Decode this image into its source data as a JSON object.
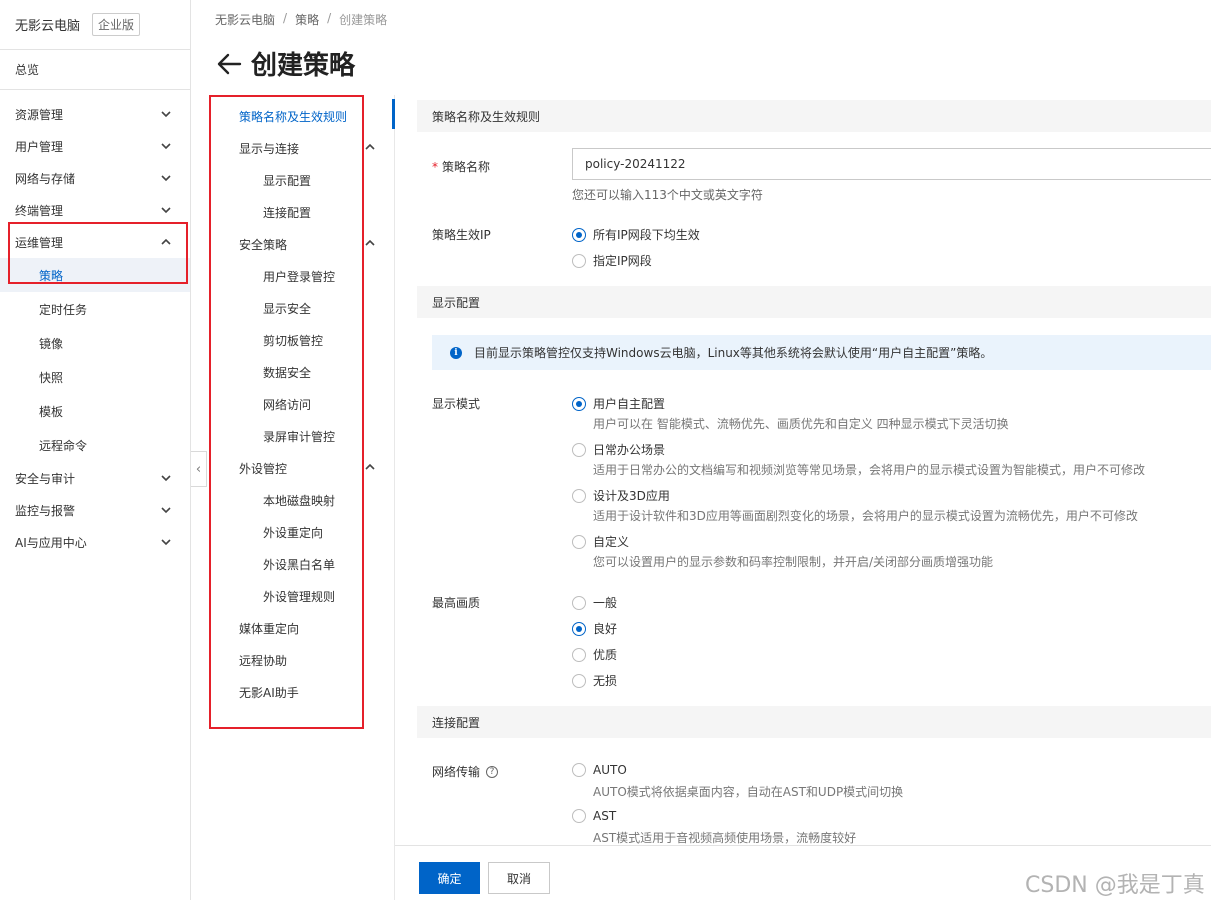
{
  "sidebar": {
    "brand": "无影云电脑",
    "edition": "企业版",
    "overview": "总览",
    "groups": [
      {
        "label": "资源管理",
        "expanded": false
      },
      {
        "label": "用户管理",
        "expanded": false
      },
      {
        "label": "网络与存储",
        "expanded": false
      },
      {
        "label": "终端管理",
        "expanded": false
      },
      {
        "label": "运维管理",
        "expanded": true
      },
      {
        "label": "安全与审计",
        "expanded": false
      },
      {
        "label": "监控与报警",
        "expanded": false
      },
      {
        "label": "AI与应用中心",
        "expanded": false
      }
    ],
    "ops_items": [
      "策略",
      "定时任务",
      "镜像",
      "快照",
      "模板",
      "远程命令"
    ],
    "active_item": "策略"
  },
  "breadcrumb": [
    "无影云电脑",
    "策略",
    "创建策略"
  ],
  "page_title": "创建策略",
  "anchor_nav": [
    {
      "label": "策略名称及生效规则",
      "level": 1,
      "active": true
    },
    {
      "label": "显示与连接",
      "level": 1,
      "collapsible": true
    },
    {
      "label": "显示配置",
      "level": 2
    },
    {
      "label": "连接配置",
      "level": 2
    },
    {
      "label": "安全策略",
      "level": 1,
      "collapsible": true
    },
    {
      "label": "用户登录管控",
      "level": 2
    },
    {
      "label": "显示安全",
      "level": 2
    },
    {
      "label": "剪切板管控",
      "level": 2
    },
    {
      "label": "数据安全",
      "level": 2
    },
    {
      "label": "网络访问",
      "level": 2
    },
    {
      "label": "录屏审计管控",
      "level": 2
    },
    {
      "label": "外设管控",
      "level": 1,
      "collapsible": true
    },
    {
      "label": "本地磁盘映射",
      "level": 2
    },
    {
      "label": "外设重定向",
      "level": 2
    },
    {
      "label": "外设黑白名单",
      "level": 2
    },
    {
      "label": "外设管理规则",
      "level": 2
    },
    {
      "label": "媒体重定向",
      "level": 1
    },
    {
      "label": "远程协助",
      "level": 1
    },
    {
      "label": "无影AI助手",
      "level": 1
    }
  ],
  "form": {
    "section_name_rules": "策略名称及生效规则",
    "policy_name_label": "策略名称",
    "policy_name_required": "*",
    "policy_name_value": "policy-20241122",
    "policy_name_help": "您还可以输入113个中文或英文字符",
    "effective_ip_label": "策略生效IP",
    "effective_ip_options": [
      {
        "label": "所有IP网段下均生效",
        "checked": true
      },
      {
        "label": "指定IP网段",
        "checked": false
      }
    ],
    "section_display": "显示配置",
    "display_notice": "目前显示策略管控仅支持Windows云电脑，Linux等其他系统将会默认使用“用户自主配置”策略。",
    "display_mode_label": "显示模式",
    "display_mode_options": [
      {
        "label": "用户自主配置",
        "desc": "用户可以在 智能模式、流畅优先、画质优先和自定义 四种显示模式下灵活切换",
        "checked": true
      },
      {
        "label": "日常办公场景",
        "desc": "适用于日常办公的文档编写和视频浏览等常见场景，会将用户的显示模式设置为智能模式，用户不可修改",
        "checked": false
      },
      {
        "label": "设计及3D应用",
        "desc": "适用于设计软件和3D应用等画面剧烈变化的场景，会将用户的显示模式设置为流畅优先，用户不可修改",
        "checked": false
      },
      {
        "label": "自定义",
        "desc": "您可以设置用户的显示参数和码率控制限制，并开启/关闭部分画质增强功能",
        "checked": false
      }
    ],
    "max_quality_label": "最高画质",
    "max_quality_options": [
      {
        "label": "一般",
        "checked": false
      },
      {
        "label": "良好",
        "checked": true
      },
      {
        "label": "优质",
        "checked": false
      },
      {
        "label": "无损",
        "checked": false
      }
    ],
    "section_connection": "连接配置",
    "network_transport_label": "网络传输",
    "network_transport_options": [
      {
        "label": "AUTO",
        "desc": "AUTO模式将依据桌面内容，自动在AST和UDP模式间切换",
        "checked": false
      },
      {
        "label": "AST",
        "desc": "AST模式适用于音视频高频使用场景，流畅度较好",
        "checked": false
      }
    ]
  },
  "footer": {
    "confirm": "确定",
    "cancel": "取消"
  },
  "watermark": "CSDN @我是丁真",
  "colors": {
    "primary": "#0064c8",
    "highlight_border": "#e5202a",
    "section_bg": "#f5f5f5",
    "notice_bg": "#eaf3fc"
  },
  "icons": [
    "chevron-down-icon",
    "chevron-up-icon",
    "back-arrow-icon",
    "info-icon",
    "help-icon",
    "chevron-left-icon"
  ]
}
